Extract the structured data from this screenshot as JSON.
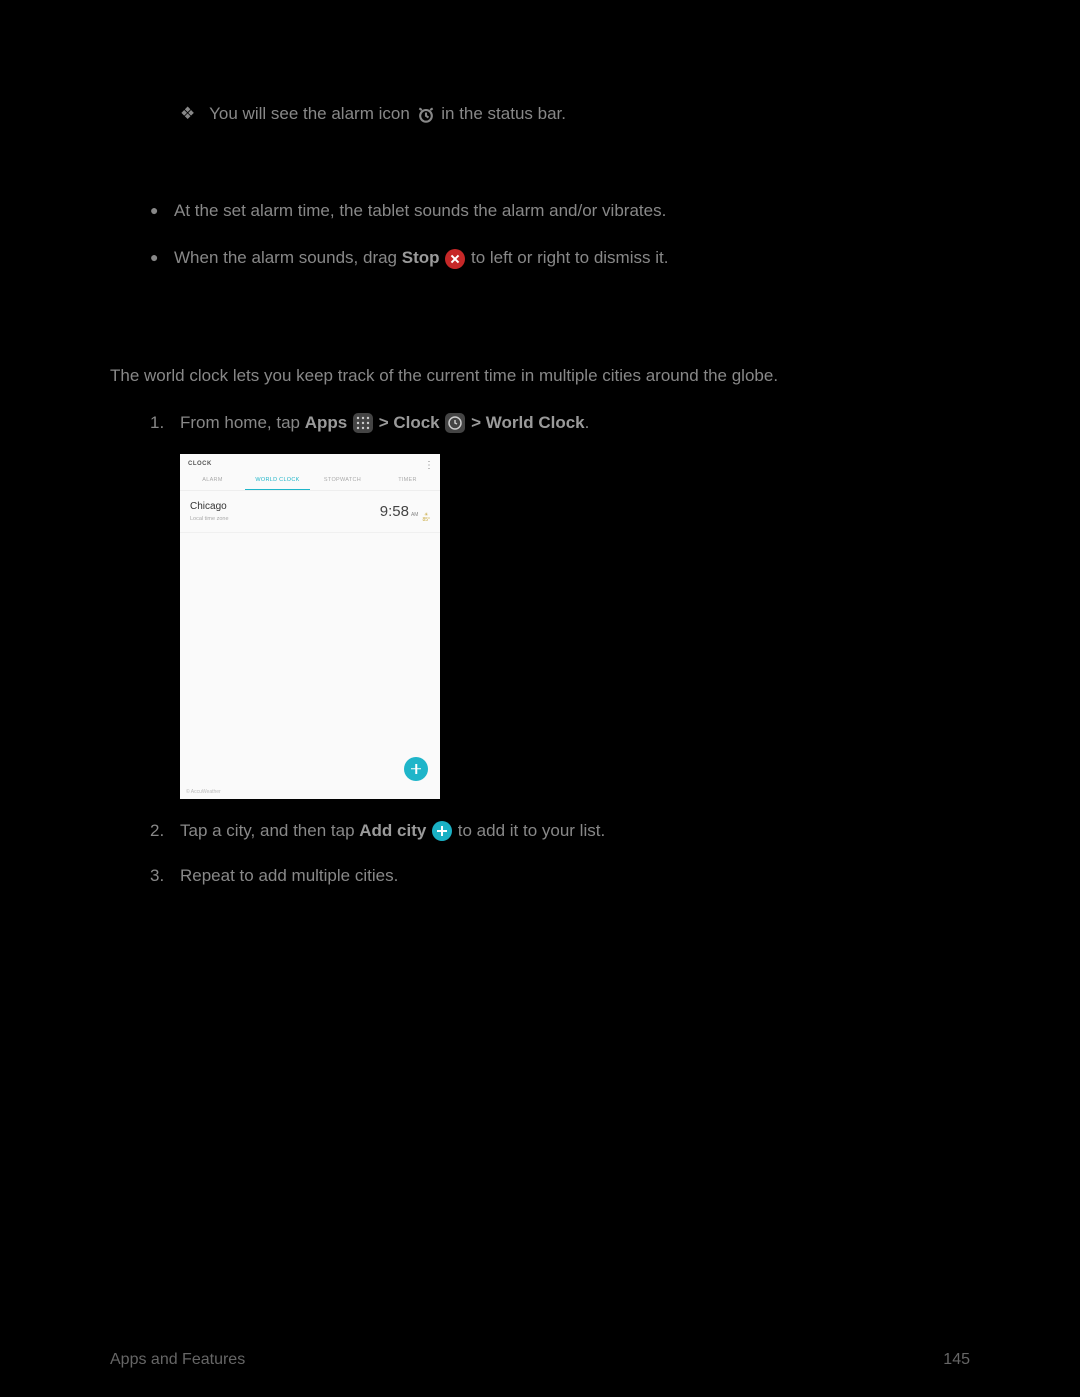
{
  "line1": {
    "diamond": "❖",
    "text_a": "You will see the alarm icon",
    "text_b": "in the status bar."
  },
  "bul1": {
    "mark": "●",
    "text": "At the set alarm time, the tablet sounds the alarm and/or vibrates."
  },
  "bul2": {
    "mark": "●",
    "text_a": "When the alarm sounds, drag ",
    "bold": "Stop",
    "text_b": " to left or right to dismiss it."
  },
  "desc": "The world clock lets you keep track of the current time in multiple cities around the globe.",
  "step1": {
    "num": "1.",
    "text_a": "From home, tap ",
    "b1": "Apps",
    "sep1": " > ",
    "b2": "Clock",
    "sep2": " > ",
    "b3": "World Clock",
    "end": "."
  },
  "screenshot": {
    "title": "CLOCK",
    "more": "⋮",
    "tabs": {
      "t1": "ALARM",
      "t2": "WORLD CLOCK",
      "t3": "STOPWATCH",
      "t4": "TIMER"
    },
    "city": {
      "name": "Chicago",
      "zone": "Local time zone",
      "time": "9:58",
      "ampm": "AM",
      "temp": "85°"
    },
    "footer": "© AccuWeather"
  },
  "step2": {
    "num": "2.",
    "text_a": "Tap a city, and then tap ",
    "bold": "Add city",
    "text_b": " to add it to your list."
  },
  "step3": {
    "num": "3.",
    "text": "Repeat to add multiple cities."
  },
  "footer": {
    "section": "Apps and Features",
    "page": "145"
  }
}
